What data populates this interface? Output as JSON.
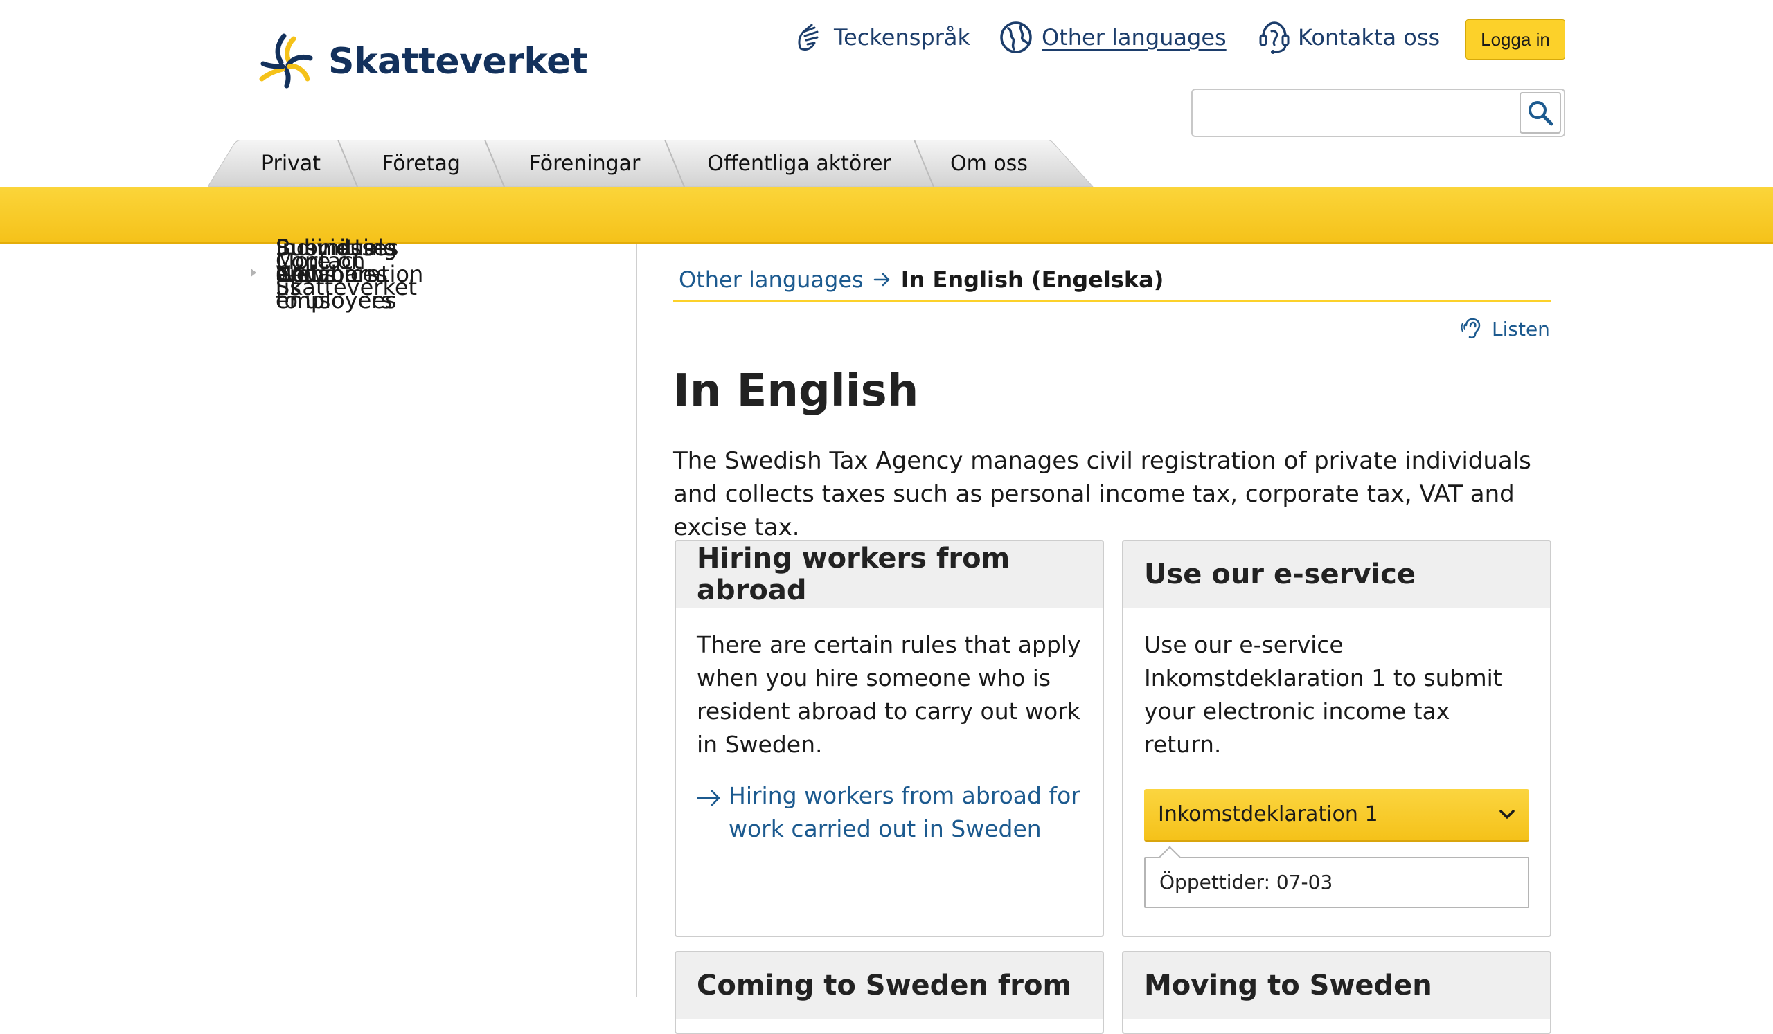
{
  "header": {
    "logo_text": "Skatteverket",
    "utility_links": [
      {
        "label": "Teckenspråk",
        "icon": "sign-language-icon"
      },
      {
        "label": "Other languages",
        "icon": "globe-icon"
      },
      {
        "label": "Kontakta oss",
        "icon": "headset-icon"
      }
    ],
    "login_label": "Logga in",
    "search": {
      "value": "",
      "placeholder": ""
    }
  },
  "tabs": [
    "Privat",
    "Företag",
    "Föreningar",
    "Offentliga aktörer",
    "Om oss"
  ],
  "sidebar": {
    "items": [
      {
        "label": "Individuals and employees",
        "expandable": true
      },
      {
        "label": "Businesses and employers",
        "expandable": true
      },
      {
        "label": "More on Skatteverket",
        "expandable": true
      },
      {
        "label": "Contact us",
        "expandable": true
      },
      {
        "label": "Submitting e-invoices to us",
        "expandable": false
      },
      {
        "label": "News",
        "expandable": true
      },
      {
        "label": "Webinars",
        "expandable": true
      },
      {
        "label": "Collaboration",
        "expandable": true
      }
    ]
  },
  "breadcrumb": {
    "parent": "Other languages",
    "current": "In English (Engelska)"
  },
  "listen_label": "Listen",
  "main": {
    "title": "In English",
    "intro": "The Swedish Tax Agency manages civil registration of private individuals and collects taxes such as personal income tax, corporate tax, VAT and excise tax.",
    "cards": [
      {
        "title": "Hiring workers from abroad",
        "text": "There are certain rules that apply when you hire someone who is resident abroad to carry out work in Sweden.",
        "link": "Hiring workers from abroad for work carried out in Sweden"
      },
      {
        "title": "Use our e-service",
        "text": "Use our e-service Inkomstdeklaration 1 to submit your electronic income tax return.",
        "dropdown_label": "Inkomstdeklaration 1",
        "hours": "Öppettider: 07-03"
      },
      {
        "title": "Coming to Sweden from"
      },
      {
        "title": "Moving to Sweden"
      }
    ]
  },
  "colors": {
    "brand_yellow": "#fcd12a",
    "brand_navy": "#13315c",
    "link_blue": "#1c5a8f"
  }
}
